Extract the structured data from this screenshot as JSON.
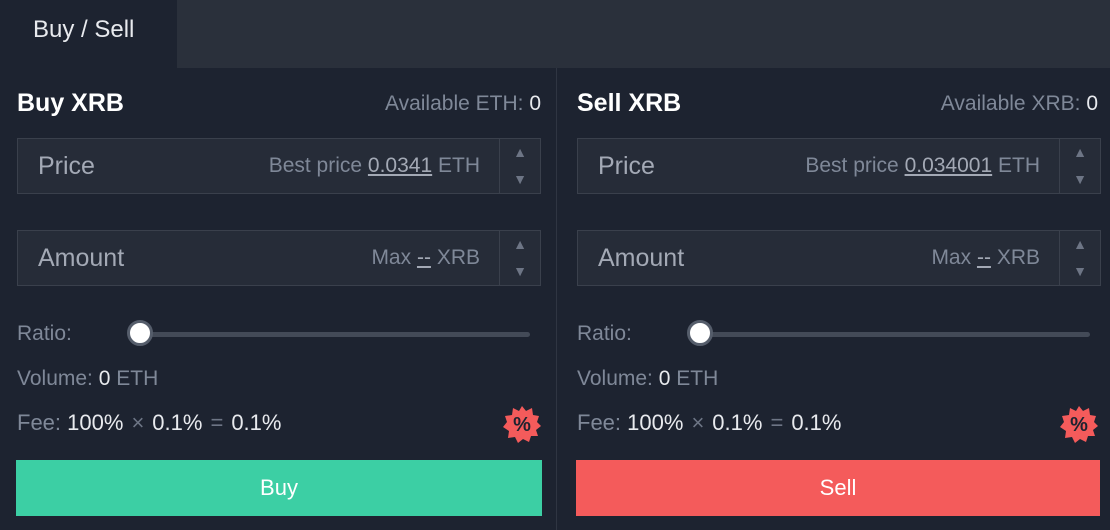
{
  "tab": {
    "label": "Buy / Sell"
  },
  "buy": {
    "title": "Buy XRB",
    "available_label": "Available ETH:",
    "available_value": "0",
    "price": {
      "label": "Price",
      "hint_prefix": "Best price",
      "hint_value": "0.0341",
      "hint_unit": "ETH"
    },
    "amount": {
      "label": "Amount",
      "hint_prefix": "Max",
      "hint_value": "--",
      "hint_unit": "XRB"
    },
    "ratio_label": "Ratio:",
    "ratio_value": 0,
    "volume_label": "Volume:",
    "volume_value": "0",
    "volume_unit": "ETH",
    "fee_label": "Fee:",
    "fee_a": "100%",
    "fee_times": "×",
    "fee_b": "0.1%",
    "fee_eq": "=",
    "fee_result": "0.1%",
    "button_label": "Buy",
    "button_color": "#3ccfa4"
  },
  "sell": {
    "title": "Sell XRB",
    "available_label": "Available XRB:",
    "available_value": "0",
    "price": {
      "label": "Price",
      "hint_prefix": "Best price",
      "hint_value": "0.034001",
      "hint_unit": "ETH"
    },
    "amount": {
      "label": "Amount",
      "hint_prefix": "Max",
      "hint_value": "--",
      "hint_unit": "XRB"
    },
    "ratio_label": "Ratio:",
    "ratio_value": 0,
    "volume_label": "Volume:",
    "volume_value": "0",
    "volume_unit": "ETH",
    "fee_label": "Fee:",
    "fee_a": "100%",
    "fee_times": "×",
    "fee_b": "0.1%",
    "fee_eq": "=",
    "fee_result": "0.1%",
    "button_label": "Sell",
    "button_color": "#f45b5b"
  },
  "icons": {
    "step_up": "▲",
    "step_down": "▼",
    "fee_badge": "%",
    "fee_badge_color": "#f45b5b"
  }
}
